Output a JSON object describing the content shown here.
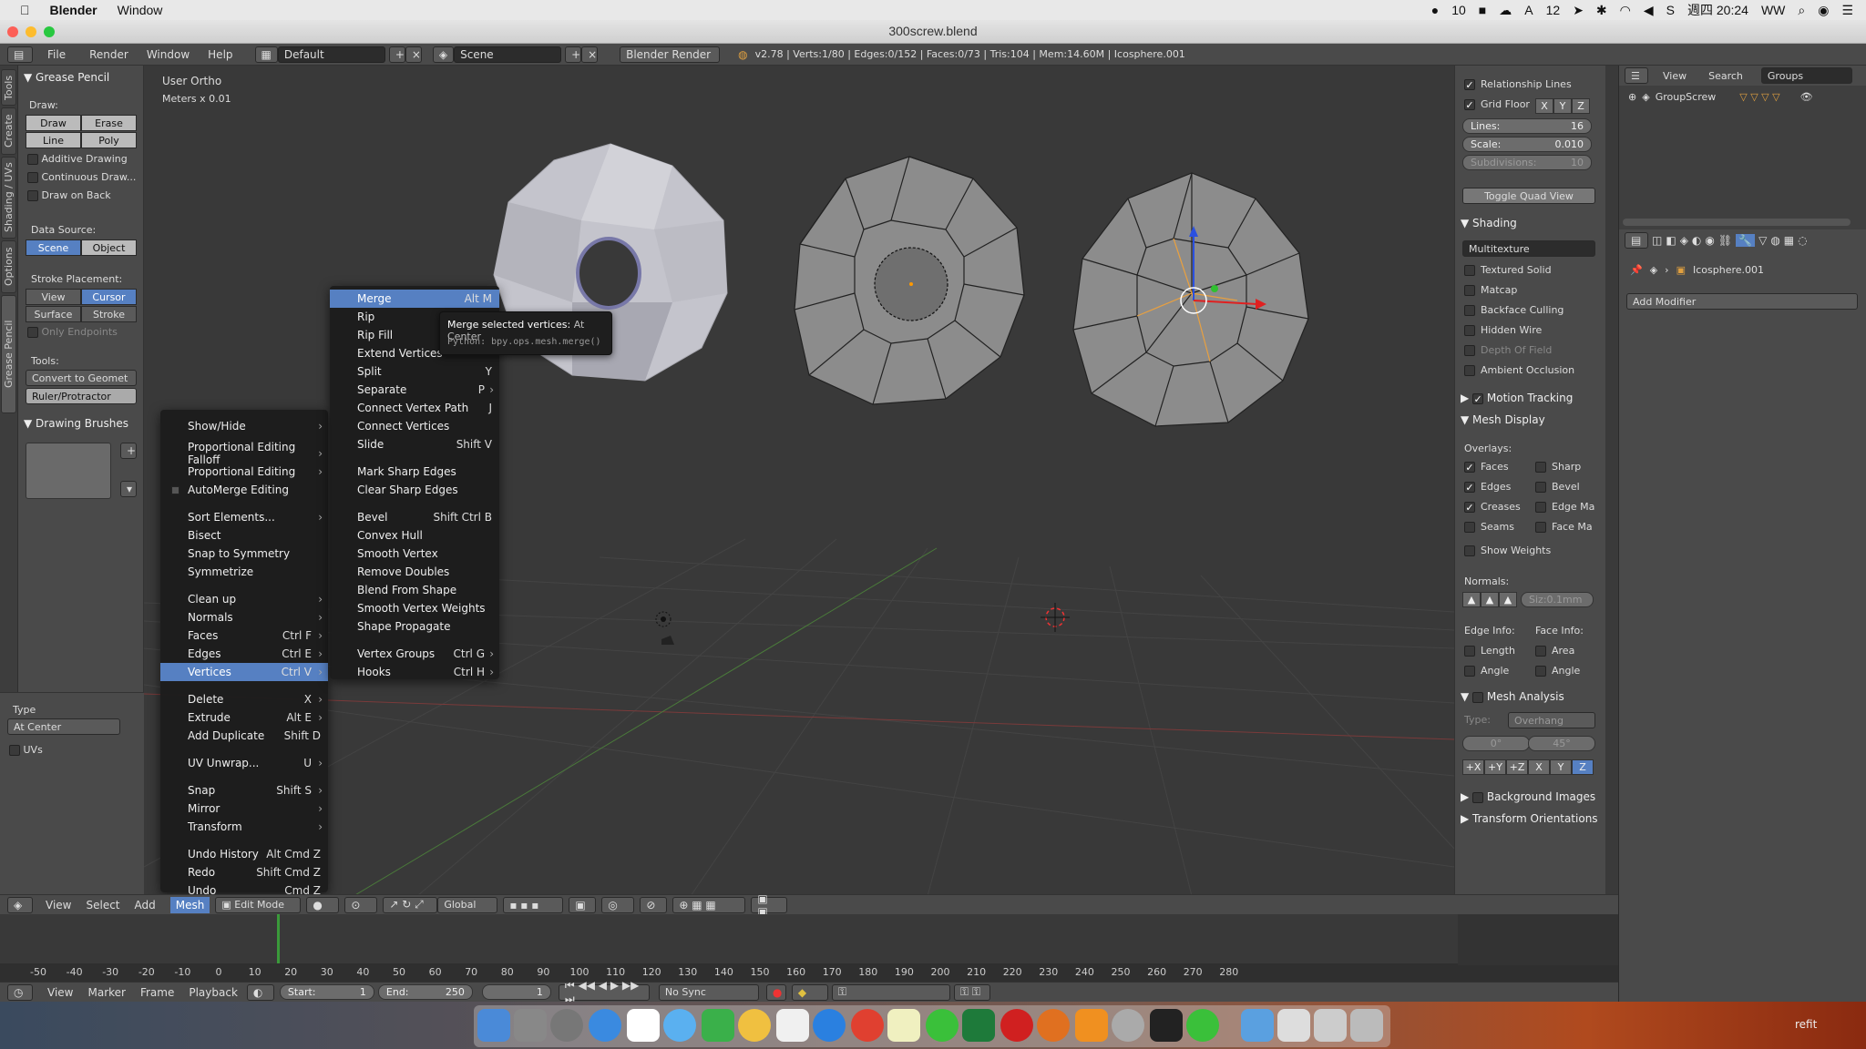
{
  "macbar": {
    "app": "Blender",
    "window_menu": "Window",
    "status_count_1": "10",
    "status_count_2": "12",
    "clock": "週四 20:24",
    "user": "WW"
  },
  "titlebar": {
    "title": "300screw.blend"
  },
  "infoheader": {
    "menus": [
      "File",
      "Render",
      "Window",
      "Help"
    ],
    "layout": "Default",
    "scene": "Scene",
    "engine": "Blender Render",
    "stats": "v2.78 | Verts:1/80 | Edges:0/152 | Faces:0/73 | Tris:104 | Mem:14.60M | Icosphere.001"
  },
  "lefttabs": [
    "Tools",
    "Create",
    "Shading / UVs",
    "Options",
    "Grease Pencil"
  ],
  "toolshelf": {
    "panel_title": "Grease Pencil",
    "draw_label": "Draw:",
    "draw": "Draw",
    "erase": "Erase",
    "line": "Line",
    "poly": "Poly",
    "additive": "Additive Drawing",
    "continuous": "Continuous Draw...",
    "drawonback": "Draw on Back",
    "datasource_label": "Data Source:",
    "scene": "Scene",
    "object": "Object",
    "stroke_label": "Stroke Placement:",
    "view": "View",
    "cursor": "Cursor",
    "surface": "Surface",
    "stroke": "Stroke",
    "only_endpoints": "Only Endpoints",
    "tools_label": "Tools:",
    "convert": "Convert to Geomet",
    "ruler": "Ruler/Protractor",
    "brushes": "Drawing Brushes",
    "type_label": "Type",
    "type_value": "At Center",
    "uvs": "UVs"
  },
  "viewport": {
    "view_name": "User Ortho",
    "units": "Meters x 0.01"
  },
  "mesh_menu": {
    "items": [
      {
        "label": "Show/Hide",
        "shortcut": "",
        "sub": true
      },
      {
        "label": "Proportional Editing Falloff",
        "shortcut": "",
        "sub": true
      },
      {
        "label": "Proportional Editing",
        "shortcut": "",
        "sub": true
      },
      {
        "label": "AutoMerge Editing",
        "shortcut": "",
        "sub": false
      },
      {
        "label": "Sort Elements...",
        "shortcut": "",
        "sub": true
      },
      {
        "label": "Bisect",
        "shortcut": "",
        "sub": false
      },
      {
        "label": "Snap to Symmetry",
        "shortcut": "",
        "sub": false
      },
      {
        "label": "Symmetrize",
        "shortcut": "",
        "sub": false
      },
      {
        "label": "Clean up",
        "shortcut": "",
        "sub": true
      },
      {
        "label": "Normals",
        "shortcut": "",
        "sub": true
      },
      {
        "label": "Faces",
        "shortcut": "Ctrl F",
        "sub": true
      },
      {
        "label": "Edges",
        "shortcut": "Ctrl E",
        "sub": true
      },
      {
        "label": "Vertices",
        "shortcut": "Ctrl V",
        "sub": true
      },
      {
        "label": "Delete",
        "shortcut": "X",
        "sub": true
      },
      {
        "label": "Extrude",
        "shortcut": "Alt E",
        "sub": true
      },
      {
        "label": "Add Duplicate",
        "shortcut": "Shift D",
        "sub": false
      },
      {
        "label": "UV Unwrap...",
        "shortcut": "U",
        "sub": true
      },
      {
        "label": "Snap",
        "shortcut": "Shift S",
        "sub": true
      },
      {
        "label": "Mirror",
        "shortcut": "",
        "sub": true
      },
      {
        "label": "Transform",
        "shortcut": "",
        "sub": true
      },
      {
        "label": "Undo History",
        "shortcut": "Alt Cmd Z",
        "sub": false
      },
      {
        "label": "Redo",
        "shortcut": "Shift Cmd Z",
        "sub": false
      },
      {
        "label": "Undo",
        "shortcut": "Cmd Z",
        "sub": false
      }
    ]
  },
  "vertices_menu": {
    "items": [
      {
        "label": "Merge",
        "shortcut": "Alt M"
      },
      {
        "label": "Rip",
        "shortcut": ""
      },
      {
        "label": "Rip Fill",
        "shortcut": ""
      },
      {
        "label": "Extend Vertices",
        "shortcut": ""
      },
      {
        "label": "Split",
        "shortcut": "Y"
      },
      {
        "label": "Separate",
        "shortcut": "P"
      },
      {
        "label": "Connect Vertex Path",
        "shortcut": "J"
      },
      {
        "label": "Connect Vertices",
        "shortcut": ""
      },
      {
        "label": "Slide",
        "shortcut": "Shift V"
      },
      {
        "label": "Mark Sharp Edges",
        "shortcut": ""
      },
      {
        "label": "Clear Sharp Edges",
        "shortcut": ""
      },
      {
        "label": "Bevel",
        "shortcut": "Shift Ctrl B"
      },
      {
        "label": "Convex Hull",
        "shortcut": ""
      },
      {
        "label": "Smooth Vertex",
        "shortcut": ""
      },
      {
        "label": "Remove Doubles",
        "shortcut": ""
      },
      {
        "label": "Blend From Shape",
        "shortcut": ""
      },
      {
        "label": "Smooth Vertex Weights",
        "shortcut": ""
      },
      {
        "label": "Shape Propagate",
        "shortcut": ""
      },
      {
        "label": "Vertex Groups",
        "shortcut": "Ctrl G"
      },
      {
        "label": "Hooks",
        "shortcut": "Ctrl H"
      }
    ]
  },
  "tooltip": {
    "title": "Merge selected vertices:",
    "value": "At Center",
    "python": "Python: bpy.ops.mesh.merge()"
  },
  "npanel": {
    "relationship_lines": "Relationship Lines",
    "grid_floor": "Grid Floor",
    "x": "X",
    "y": "Y",
    "z": "Z",
    "lines_label": "Lines:",
    "lines_value": "16",
    "scale_label": "Scale:",
    "scale_value": "0.010",
    "subdiv_label": "Subdivisions:",
    "subdiv_value": "10",
    "toggle_quad": "Toggle Quad View",
    "shading": "Shading",
    "multitexture": "Multitexture",
    "textured_solid": "Textured Solid",
    "matcap": "Matcap",
    "backface": "Backface Culling",
    "hidden_wire": "Hidden Wire",
    "dof": "Depth Of Field",
    "ao": "Ambient Occlusion",
    "motion_tracking": "Motion Tracking",
    "mesh_display": "Mesh Display",
    "overlays": "Overlays:",
    "faces": "Faces",
    "sharp": "Sharp",
    "edges": "Edges",
    "bevel": "Bevel",
    "creases": "Creases",
    "edge_ma": "Edge Ma",
    "seams": "Seams",
    "face_ma": "Face Ma",
    "show_weights": "Show Weights",
    "normals": "Normals:",
    "normal_size": "Siz:0.1mm",
    "edge_info": "Edge Info:",
    "face_info": "Face Info:",
    "length": "Length",
    "area": "Area",
    "angle1": "Angle",
    "angle2": "Angle",
    "mesh_analysis": "Mesh Analysis",
    "type_label": "Type:",
    "type_value": "Overhang",
    "min_angle": "0°",
    "max_angle": "45°",
    "axes": [
      "+X",
      "+Y",
      "+Z",
      "X",
      "Y",
      "Z"
    ],
    "background_images": "Background Images",
    "transform_orient": "Transform Orientations"
  },
  "outliner": {
    "view": "View",
    "search": "Search",
    "groups": "Groups",
    "item": "GroupScrew"
  },
  "props": {
    "object": "Icosphere.001",
    "add_modifier": "Add Modifier"
  },
  "v3dheader": {
    "view": "View",
    "select": "Select",
    "add": "Add",
    "mesh": "Mesh",
    "mode": "Edit Mode",
    "orientation": "Global"
  },
  "timeline": {
    "ticks": [
      "-50",
      "-40",
      "-30",
      "-20",
      "-10",
      "0",
      "10",
      "20",
      "30",
      "40",
      "50",
      "60",
      "70",
      "80",
      "90",
      "100",
      "110",
      "120",
      "130",
      "140",
      "150",
      "160",
      "170",
      "180",
      "190",
      "200",
      "210",
      "220",
      "230",
      "240",
      "250",
      "260",
      "270",
      "280"
    ],
    "view": "View",
    "marker": "Marker",
    "frame": "Frame",
    "playback": "Playback",
    "start_label": "Start:",
    "start": "1",
    "end_label": "End:",
    "end": "250",
    "current": "1",
    "sync": "No Sync"
  },
  "dock_label": "refit"
}
